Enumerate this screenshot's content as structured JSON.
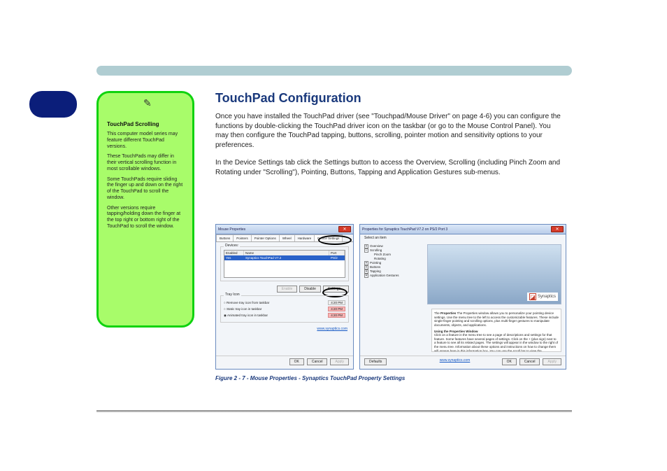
{
  "header": {
    "section_title": "TouchPad Configuration",
    "paragraph1": "Once you have installed the TouchPad driver (see \"Touchpad/Mouse Driver\" on page 4-6) you can configure the functions by double-clicking the TouchPad driver icon on the taskbar (or go to the Mouse Control Panel). You may then configure the TouchPad tapping, buttons, scrolling, pointer motion and sensitivity options to your preferences.",
    "paragraph2": "In the Device Settings tab click the Settings button to access the Overview, Scrolling (including Pinch Zoom and Rotating under \"Scrolling\"), Pointing, Buttons, Tapping and Application Gestures sub-menus."
  },
  "sidebar": {
    "title": "TouchPad Scrolling",
    "text1": "This computer model series may feature different TouchPad versions.",
    "text2": "These TouchPads may differ in their vertical scrolling function in most scrollable windows.",
    "text3": "Some TouchPads require sliding the finger up and down on the right of the TouchPad to scroll the window.",
    "text4": "Other versions require tapping/holding down the finger at the top right or bottom right of the TouchPad to scroll the window."
  },
  "dialog1": {
    "title": "Mouse Properties",
    "tabs": [
      "Buttons",
      "Pointers",
      "Pointer Options",
      "Wheel",
      "Hardware",
      "Device Settings"
    ],
    "devices_label": "Devices:",
    "col_enabled": "Enabled",
    "col_name": "Name",
    "col_port": "Port",
    "row_enabled": "Yes",
    "row_name": "Synaptics TouchPad V7.2",
    "row_port": "PS/2",
    "btn_enable": "Enable",
    "btn_disable": "Disable",
    "btn_settings": "Settings…",
    "tray_label": "Tray Icon",
    "tray_opt1": "Remove tray icon from taskbar",
    "tray_opt2": "Static tray icon in taskbar",
    "tray_opt3": "Animated tray icon in taskbar",
    "time": "4:20 PM",
    "link": "www.synaptics.com",
    "ok": "OK",
    "cancel": "Cancel",
    "apply": "Apply"
  },
  "dialog2": {
    "title": "Properties for Synaptics TouchPad V7.2 on PS/2 Port 3",
    "select_label": "Select an item",
    "tree": {
      "overview": "Overview",
      "scrolling": "Scrolling",
      "pinch": "Pinch Zoom",
      "rotating": "Rotating",
      "pointing": "Pointing",
      "buttons": "Buttons",
      "tapping": "Tapping",
      "gestures": "Application Gestures"
    },
    "logo_text": "Synaptics",
    "desc_p1_bold": "Properties",
    "desc_p1": "The Properties window allows you to personalize your pointing device settings. Use the menu tree to the left to access the customizable features. These include single-finger pointing and scrolling options, plus multi-finger gestures to manipulate documents, objects, and applications.",
    "desc_h": "Using the Properties Window",
    "desc_p2": "Click on a feature in the menu tree to see a page of descriptions and settings for that feature. Some features have several pages of settings. Click on the + (plus sign) next to a feature to see all its related pages. The settings will appear in the window to the right of the menu tree. Information about these options and instructions on how to change them will appear here in this information box. You can use the scroll bar to view the",
    "defaults": "Defaults",
    "link": "www.synaptics.com",
    "ok": "OK",
    "cancel": "Cancel",
    "apply": "Apply"
  },
  "figure": {
    "label": "Figure 2 - 7 - Mouse Properties - Synaptics TouchPad Property Settings"
  }
}
